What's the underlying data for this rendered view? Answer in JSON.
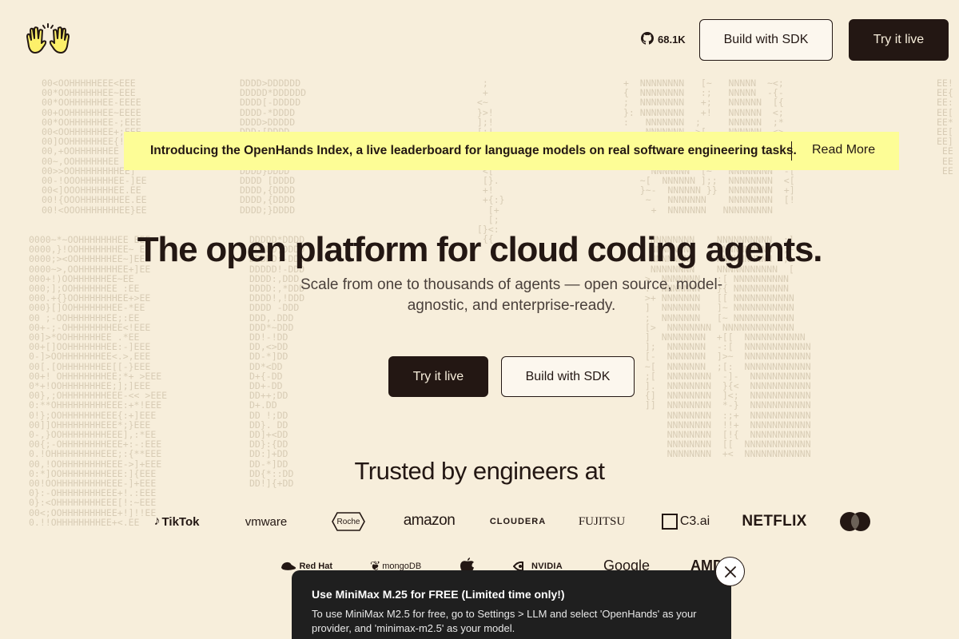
{
  "header": {
    "github_stars": "68.1K",
    "build_sdk_label": "Build with SDK",
    "try_live_label": "Try it live"
  },
  "announcement": {
    "text": "Introducing the OpenHands Index, a live leaderboard for language models on real software engineering tasks.",
    "link_label": "Read More"
  },
  "hero": {
    "title": "The open platform for cloud coding agents.",
    "subtitle": "Scale from one to thousands of agents — open source, model-agnostic, and enterprise-ready.",
    "try_live_label": "Try it live",
    "build_sdk_label": "Build with SDK"
  },
  "trusted": {
    "heading": "Trusted by engineers at",
    "row1": [
      "TikTok",
      "vmware",
      "Roche",
      "amazon",
      "CLOUDERA",
      "FUJITSU",
      "C3.ai",
      "NETFLIX"
    ],
    "row2": [
      "Red Hat",
      "mongoDB",
      "NVIDIA",
      "Google",
      "AMD"
    ]
  },
  "toast": {
    "title": "Use MiniMax M.25 for FREE (Limited time only!)",
    "body": "To use MiniMax M2.5 for free, go to Settings > LLM and select 'OpenHands' as your provider, and 'minimax-m2.5' as your model."
  },
  "colors": {
    "background": "#f7eedb",
    "dark": "#231713",
    "announcement": "#fdfd96",
    "toast": "#1f1f1f"
  }
}
